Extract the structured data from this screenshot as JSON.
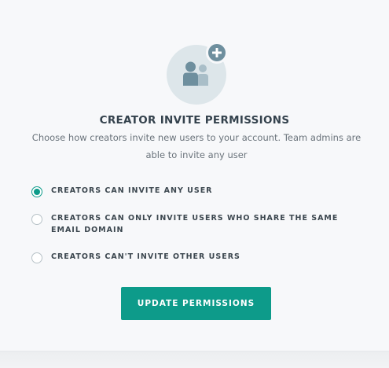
{
  "dialog": {
    "title": "CREATOR INVITE PERMISSIONS",
    "description": "Choose how creators invite new users to your account. Team admins are able to invite any user",
    "icon": "users-add-icon"
  },
  "options": [
    {
      "label": "CREATORS CAN INVITE ANY USER",
      "selected": true
    },
    {
      "label": "CREATORS CAN ONLY INVITE USERS WHO SHARE THE SAME EMAIL DOMAIN",
      "selected": false
    },
    {
      "label": "CREATORS CAN'T INVITE OTHER USERS",
      "selected": false
    }
  ],
  "actions": {
    "update_label": "UPDATE PERMISSIONS"
  },
  "colors": {
    "accent": "#0d9b8a",
    "icon_bg": "#dde6ea",
    "icon_fg": "#6e8f9e"
  }
}
